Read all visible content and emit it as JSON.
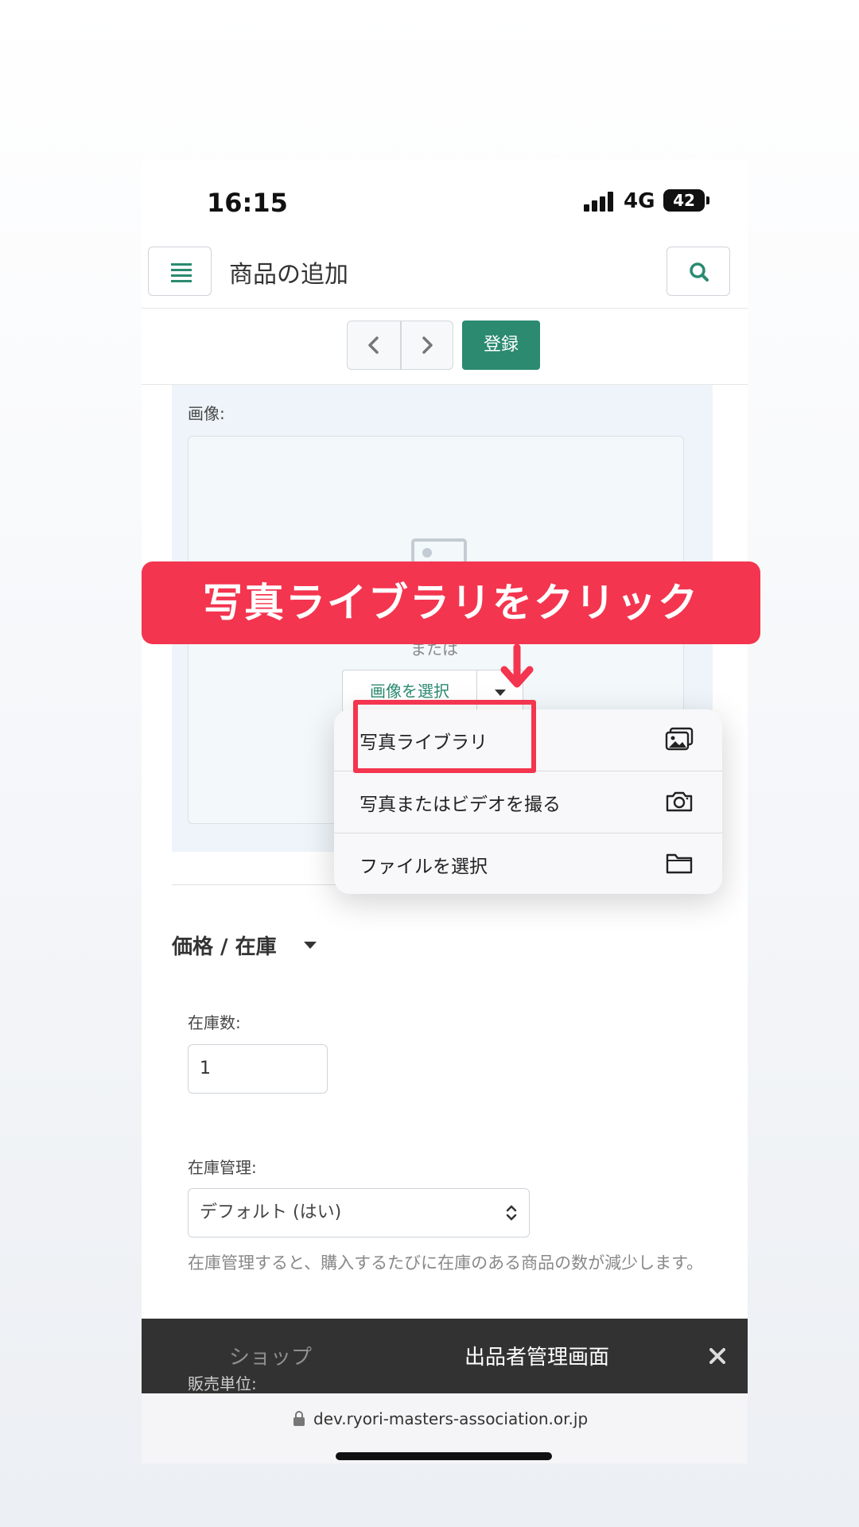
{
  "status_bar": {
    "time": "16:15",
    "network": "4G",
    "battery": "42"
  },
  "header": {
    "title": "商品の追加"
  },
  "toolbar": {
    "register_label": "登録"
  },
  "image_field": {
    "label": "画像:",
    "or_text": "または",
    "select_button": "画像を選択"
  },
  "annotation": {
    "text": "写真ライブラリをクリック"
  },
  "popup_menu": {
    "items": [
      {
        "label": "写真ライブラリ",
        "icon": "photo-library-icon"
      },
      {
        "label": "写真またはビデオを撮る",
        "icon": "camera-icon"
      },
      {
        "label": "ファイルを選択",
        "icon": "folder-icon"
      }
    ]
  },
  "price_section": {
    "heading": "価格 / 在庫"
  },
  "stock_field": {
    "label": "在庫数:",
    "value": "1"
  },
  "stock_management": {
    "label": "在庫管理:",
    "selected": "デフォルト (はい)",
    "help": "在庫管理すると、購入するたびに在庫のある商品の数が減少します。"
  },
  "sales_unit": {
    "label": "販売単位:"
  },
  "bottom_bar": {
    "tab_shop": "ショップ",
    "tab_seller": "出品者管理画面"
  },
  "url_bar": {
    "url": "dev.ryori-masters-association.or.jp"
  },
  "colors": {
    "accent": "#2b8a70",
    "annotation": "#f4354f",
    "bottom_bar": "#323232"
  }
}
